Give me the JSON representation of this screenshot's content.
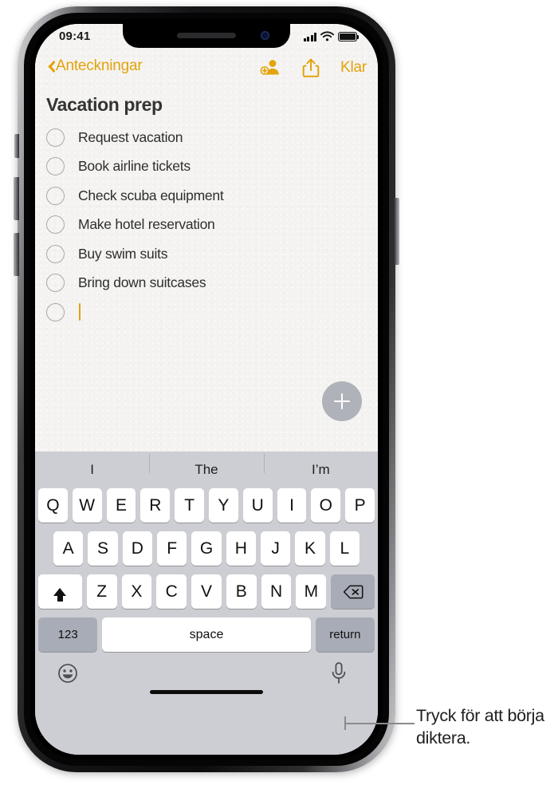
{
  "status_bar": {
    "time": "09:41",
    "signal_icon": "cellular-signal-icon",
    "wifi_icon": "wifi-icon",
    "battery_icon": "battery-icon"
  },
  "navbar": {
    "back_label": "Anteckningar",
    "back_chevron_icon": "chevron-left-icon",
    "add_person_icon": "add-person-icon",
    "share_icon": "share-icon",
    "done_label": "Klar",
    "accent_color": "#e3a30c"
  },
  "note": {
    "title": "Vacation prep",
    "background_color": "#f4f3f1",
    "checklist": [
      {
        "text": "Request vacation",
        "checked": false
      },
      {
        "text": "Book airline tickets",
        "checked": false
      },
      {
        "text": "Check scuba equipment",
        "checked": false
      },
      {
        "text": "Make hotel reservation",
        "checked": false
      },
      {
        "text": "Buy swim suits",
        "checked": false
      },
      {
        "text": "Bring down suitcases",
        "checked": false
      },
      {
        "text": "",
        "checked": false,
        "active": true
      }
    ],
    "add_button_icon": "plus-icon",
    "add_button_color": "#b0b2b9"
  },
  "keyboard": {
    "background_color": "#cdced3",
    "predictions": [
      "I",
      "The",
      "I’m"
    ],
    "row1": [
      "Q",
      "W",
      "E",
      "R",
      "T",
      "Y",
      "U",
      "I",
      "O",
      "P"
    ],
    "row2": [
      "A",
      "S",
      "D",
      "F",
      "G",
      "H",
      "J",
      "K",
      "L"
    ],
    "row3": [
      "Z",
      "X",
      "C",
      "V",
      "B",
      "N",
      "M"
    ],
    "shift_icon": "shift-arrow-up-icon",
    "delete_icon": "backspace-delete-icon",
    "numbers_label": "123",
    "space_label": "space",
    "return_label": "return",
    "emoji_icon": "emoji-smiley-icon",
    "mic_icon": "microphone-icon"
  },
  "callout": {
    "text": "Tryck för att börja diktera."
  }
}
